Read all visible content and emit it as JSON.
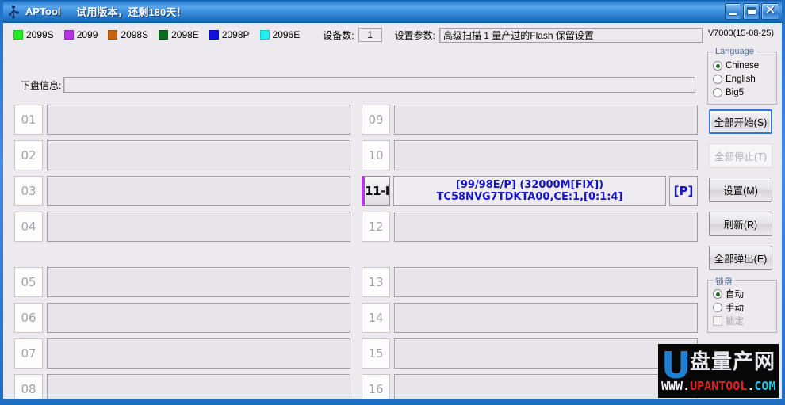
{
  "window": {
    "icon": "usb-icon",
    "title": "APTool",
    "trial_notice": "试用版本，还剩180天！",
    "minimize_label": "–",
    "maximize_label": "□",
    "close_label": "✕"
  },
  "toolbar": {
    "legend": [
      {
        "label": "2099S",
        "color": "#22ee22"
      },
      {
        "label": "2099",
        "color": "#b832e8"
      },
      {
        "label": "2098S",
        "color": "#c36510"
      },
      {
        "label": "2098E",
        "color": "#0a6b1c"
      },
      {
        "label": "2098P",
        "color": "#1010e0"
      },
      {
        "label": "2096E",
        "color": "#20f0f0"
      }
    ],
    "device_count_label": "设备数:",
    "device_count_value": "1",
    "param_label": "设置参数:",
    "param_value": "高级扫描 1 量产过的Flash 保留设置",
    "version": "V7000(15-08-25)"
  },
  "info": {
    "label": "下盘信息:",
    "value": ""
  },
  "slots": [
    {
      "num": "01",
      "active": false,
      "line1": "",
      "line2": "",
      "badge": ""
    },
    {
      "num": "02",
      "active": false,
      "line1": "",
      "line2": "",
      "badge": ""
    },
    {
      "num": "03",
      "active": false,
      "line1": "",
      "line2": "",
      "badge": ""
    },
    {
      "num": "04",
      "active": false,
      "line1": "",
      "line2": "",
      "badge": ""
    },
    {
      "num": "05",
      "active": false,
      "line1": "",
      "line2": "",
      "badge": ""
    },
    {
      "num": "06",
      "active": false,
      "line1": "",
      "line2": "",
      "badge": ""
    },
    {
      "num": "07",
      "active": false,
      "line1": "",
      "line2": "",
      "badge": ""
    },
    {
      "num": "08",
      "active": false,
      "line1": "",
      "line2": "",
      "badge": ""
    },
    {
      "num": "09",
      "active": false,
      "line1": "",
      "line2": "",
      "badge": ""
    },
    {
      "num": "10",
      "active": false,
      "line1": "",
      "line2": "",
      "badge": ""
    },
    {
      "num": "11-I",
      "active": true,
      "line1": "[99/98E/P]  (32000M[FIX])",
      "line2": "TC58NVG7TDKTA00,CE:1,[0:1:4]",
      "badge": "[P]",
      "indicator_color": "#b832e8"
    },
    {
      "num": "12",
      "active": false,
      "line1": "",
      "line2": "",
      "badge": ""
    },
    {
      "num": "13",
      "active": false,
      "line1": "",
      "line2": "",
      "badge": ""
    },
    {
      "num": "14",
      "active": false,
      "line1": "",
      "line2": "",
      "badge": ""
    },
    {
      "num": "15",
      "active": false,
      "line1": "",
      "line2": "",
      "badge": ""
    },
    {
      "num": "16",
      "active": false,
      "line1": "",
      "line2": "",
      "badge": ""
    }
  ],
  "language": {
    "title": "Language",
    "options": [
      {
        "label": "Chinese",
        "selected": true
      },
      {
        "label": "English",
        "selected": false
      },
      {
        "label": "Big5",
        "selected": false
      }
    ]
  },
  "buttons": {
    "start_all": "全部开始(S)",
    "stop_all": "全部停止(T)",
    "settings": "设置(M)",
    "refresh": "刷新(R)",
    "eject_all": "全部弹出(E)"
  },
  "lock": {
    "title": "锁盘",
    "options": [
      {
        "label": "自动",
        "selected": true
      },
      {
        "label": "手动",
        "selected": false
      }
    ],
    "checkbox_label": "锁定"
  },
  "watermark": {
    "u": "U",
    "chinese": "盘量产网",
    "url_w": "WWW",
    "url_dot1": ".",
    "url_name": "UPANTOOL",
    "url_dot2": ".",
    "url_com": "COM"
  }
}
